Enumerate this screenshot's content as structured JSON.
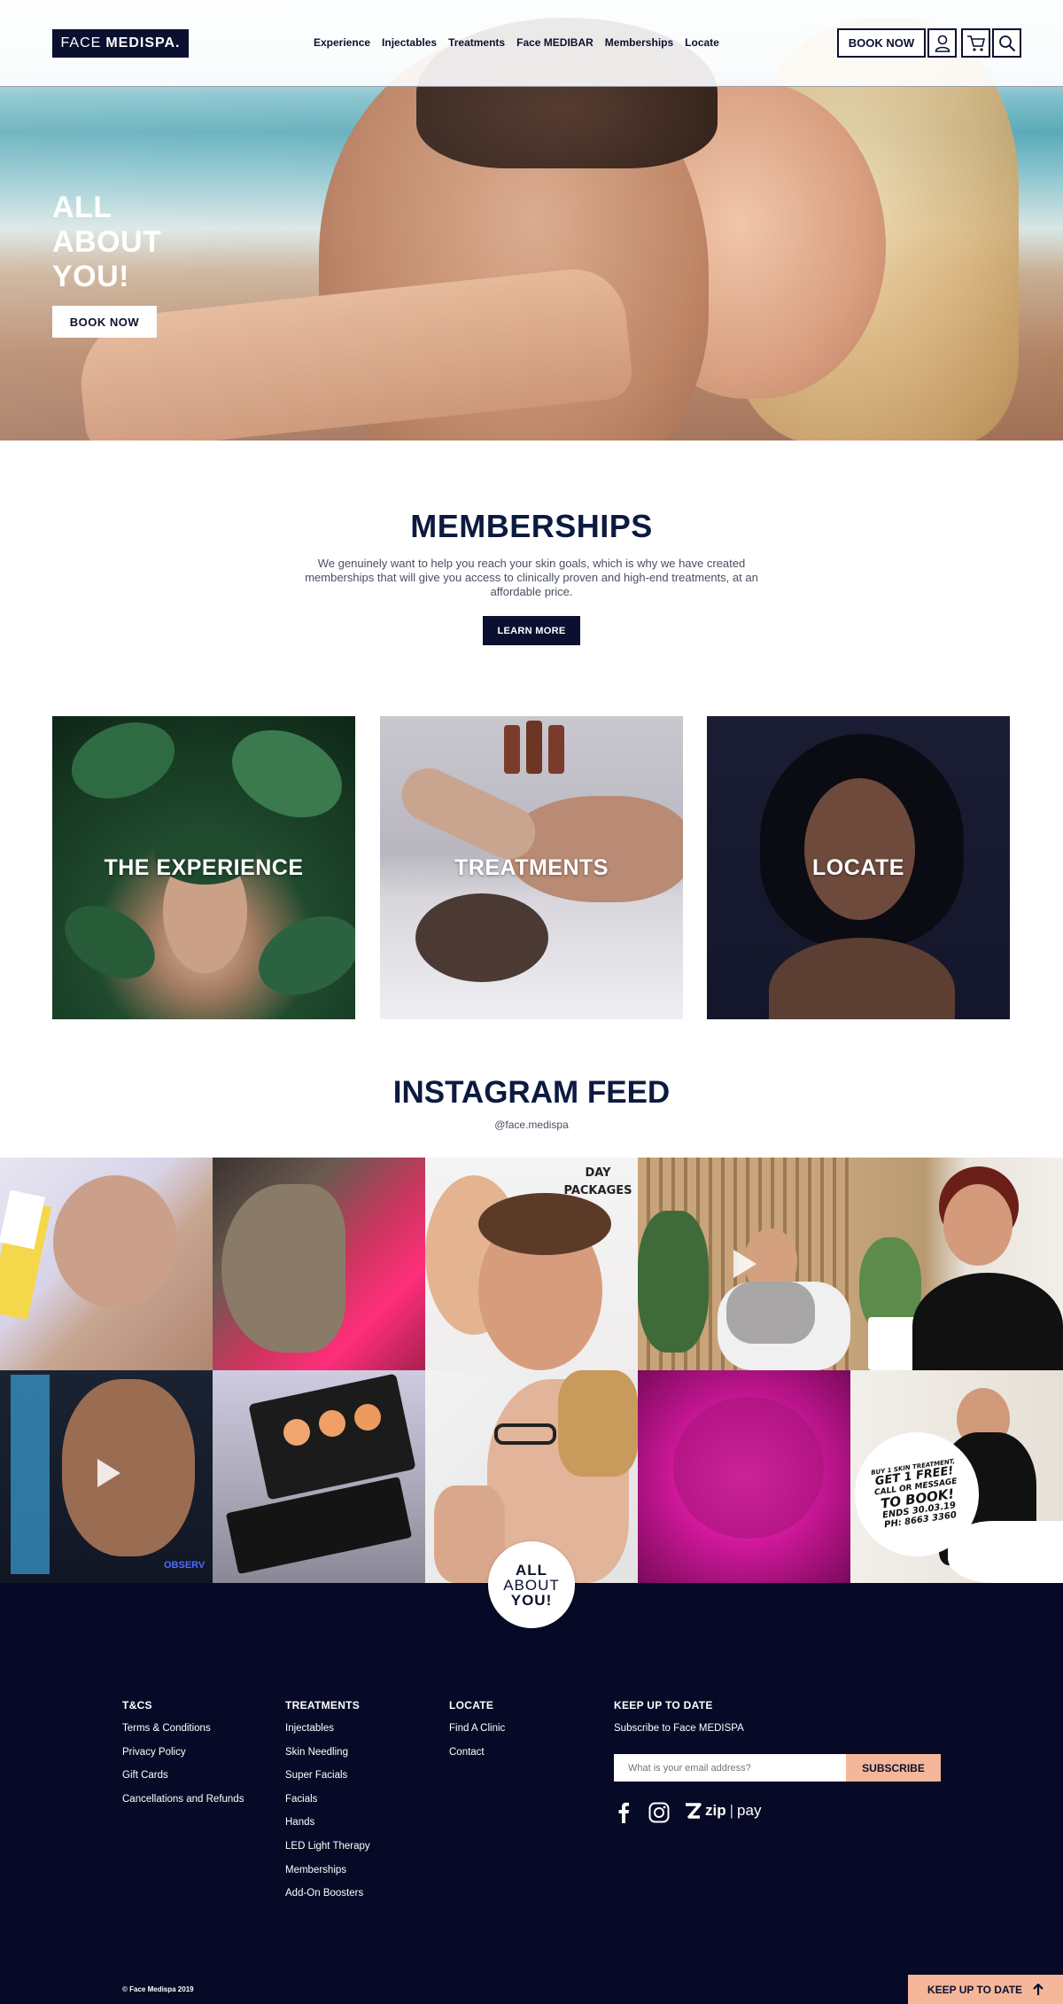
{
  "header": {
    "logo_light": "FACE",
    "logo_bold": "MEDISPA.",
    "nav": [
      "Experience",
      "Injectables",
      "Treatments",
      "Face MEDIBAR",
      "Memberships",
      "Locate"
    ],
    "book_label": "BOOK NOW",
    "icons": [
      "user-icon",
      "cart-icon",
      "search-icon"
    ]
  },
  "hero": {
    "title_lines": [
      "ALL",
      "ABOUT",
      "YOU!"
    ],
    "button_label": "BOOK NOW"
  },
  "memberships": {
    "title": "MEMBERSHIPS",
    "text": "We genuinely want to help you reach your skin goals, which is why we have created memberships that will give you access to clinically proven and high-end treatments, at an affordable price.",
    "button_label": "LEARN MORE"
  },
  "tiles": [
    "THE EXPERIENCE",
    "TREATMENTS",
    "LOCATE"
  ],
  "instagram": {
    "title": "INSTAGRAM FEED",
    "handle": "@face.medispa",
    "post_texts": {
      "day_packages": [
        "DAY",
        "PACKAGES"
      ],
      "observ": "OBSERV",
      "promo": [
        "BUY 1 SKIN TREATMENT,",
        "GET 1 FREE!",
        "CALL OR MESSAGE",
        "TO BOOK!",
        "ENDS 30.03.19",
        "PH: 8663 3360"
      ]
    },
    "badge_lines": [
      "ALL",
      "ABOUT",
      "YOU!"
    ]
  },
  "footer": {
    "columns": [
      {
        "title": "T&CS",
        "links": [
          "Terms & Conditions",
          "Privacy Policy",
          "Gift Cards",
          "Cancellations and Refunds"
        ]
      },
      {
        "title": "TREATMENTS",
        "links": [
          "Injectables",
          "Skin Needling",
          "Super Facials",
          "Facials",
          "Hands",
          "LED Light Therapy",
          "Memberships",
          "Add-On Boosters"
        ]
      },
      {
        "title": "LOCATE",
        "links": [
          "Find A Clinic",
          "Contact"
        ]
      }
    ],
    "newsletter": {
      "title": "KEEP UP TO DATE",
      "subtitle": "Subscribe to Face MEDISPA",
      "placeholder": "What is your email address?",
      "button_label": "SUBSCRIBE"
    },
    "zip_brand": "zip",
    "zip_pay": "pay",
    "copyright": "© Face Medispa 2019",
    "keep_label": "KEEP UP TO DATE"
  },
  "colors": {
    "navy": "#0c1030",
    "footer_bg": "#070a26",
    "accent_peach": "#f4b79a"
  }
}
